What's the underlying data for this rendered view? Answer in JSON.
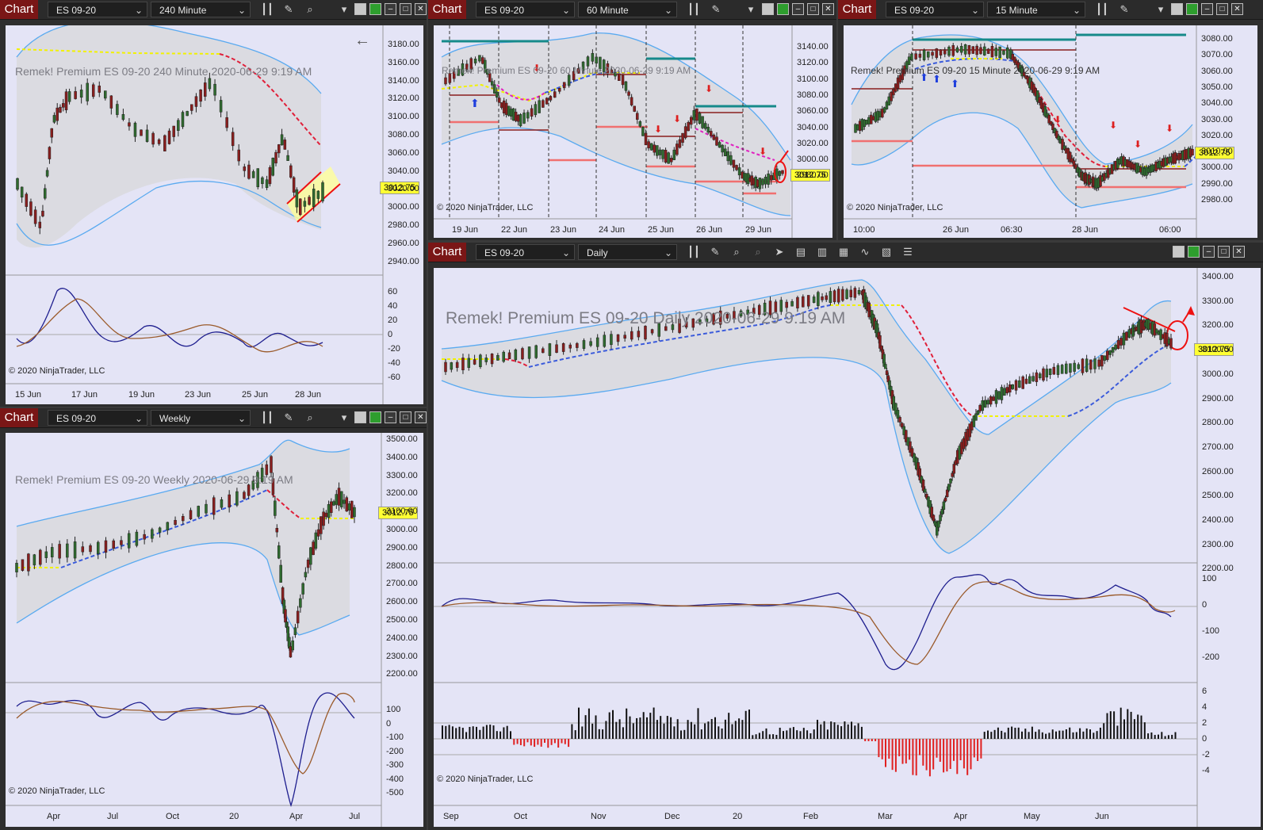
{
  "chart_windows": [
    {
      "tab": "Chart",
      "instrument": "ES 09-20",
      "period": "240 Minute",
      "overlay": "Remek!  Premium  ES 09-20  240 Minute  2020-06-29 9:19 AM",
      "copyright": "© 2020 NinjaTrader, LLC",
      "price_label": "3012.75",
      "x_ticks": [
        "15 Jun",
        "17 Jun",
        "19 Jun",
        "23 Jun",
        "25 Jun",
        "28 Jun"
      ],
      "y_ticks": [
        "3180.00",
        "3160.00",
        "3140.00",
        "3120.00",
        "3100.00",
        "3080.00",
        "3060.00",
        "3040.00",
        "3020.00",
        "3000.00",
        "2980.00",
        "2960.00",
        "2940.00"
      ],
      "osc_ticks": [
        "60",
        "40",
        "20",
        "0",
        "-20",
        "-40",
        "-60"
      ]
    },
    {
      "tab": "Chart",
      "instrument": "ES 09-20",
      "period": "60 Minute",
      "overlay": "Remek!  Premium  ES 09-20  60 Minute  2020-06-29 9:19 AM",
      "copyright": "© 2020 NinjaTrader, LLC",
      "price_label": "3012.75",
      "x_ticks": [
        "19 Jun",
        "22 Jun",
        "23 Jun",
        "24 Jun",
        "25 Jun",
        "26 Jun",
        "29 Jun"
      ],
      "y_ticks": [
        "3140.00",
        "3120.00",
        "3100.00",
        "3080.00",
        "3060.00",
        "3040.00",
        "3020.00",
        "3000.00",
        "2980.00"
      ]
    },
    {
      "tab": "Chart",
      "instrument": "ES 09-20",
      "period": "15 Minute",
      "overlay": "Remek!  Premium  ES 09-20  15 Minute  2020-06-29 9:19 AM",
      "copyright": "© 2020 NinjaTrader, LLC",
      "price_label": "3012.75",
      "x_ticks": [
        "10:00",
        "26 Jun",
        "06:30",
        "28 Jun",
        "06:00"
      ],
      "y_ticks": [
        "3080.00",
        "3070.00",
        "3060.00",
        "3050.00",
        "3040.00",
        "3030.00",
        "3020.00",
        "3010.00",
        "3000.00",
        "2990.00",
        "2980.00"
      ]
    },
    {
      "tab": "Chart",
      "instrument": "ES 09-20",
      "period": "Weekly",
      "overlay": "Remek!  Premium  ES 09-20  Weekly  2020-06-29 9:19 AM",
      "copyright": "© 2020 NinjaTrader, LLC",
      "price_label": "3012.75",
      "x_ticks": [
        "Apr",
        "Jul",
        "Oct",
        "20",
        "Apr",
        "Jul"
      ],
      "y_ticks": [
        "3500.00",
        "3400.00",
        "3300.00",
        "3200.00",
        "3100.00",
        "3000.00",
        "2900.00",
        "2800.00",
        "2700.00",
        "2600.00",
        "2500.00",
        "2400.00",
        "2300.00",
        "2200.00"
      ],
      "osc_ticks": [
        "100",
        "0",
        "-100",
        "-200",
        "-300",
        "-400",
        "-500"
      ]
    },
    {
      "tab": "Chart",
      "instrument": "ES 09-20",
      "period": "Daily",
      "overlay": "Remek!  Premium  ES 09-20  Daily  2020-06-29 9:19 AM",
      "copyright": "© 2020 NinjaTrader, LLC",
      "price_label": "3012.75",
      "x_ticks": [
        "Sep",
        "Oct",
        "Nov",
        "Dec",
        "20",
        "Feb",
        "Mar",
        "Apr",
        "May",
        "Jun"
      ],
      "y_ticks": [
        "3400.00",
        "3300.00",
        "3200.00",
        "3100.00",
        "3000.00",
        "2900.00",
        "2800.00",
        "2700.00",
        "2600.00",
        "2500.00",
        "2400.00",
        "2300.00",
        "2200.00"
      ],
      "osc_ticks": [
        "100",
        "0",
        "-100",
        "-200"
      ],
      "hist_ticks": [
        "6",
        "4",
        "2",
        "0",
        "-2",
        "-4"
      ]
    }
  ],
  "colors": {
    "bg": "#e4e4f6",
    "band": "#5aaaf0",
    "up": "#2f6b2f",
    "down": "#8a1e1e",
    "price_label": "#ffff33",
    "tab": "#7a1616",
    "osc_fast": "#1f1f8f",
    "osc_slow": "#9a5a2a"
  },
  "icons": [
    "bars-icon",
    "pencil-icon",
    "zoom-icon",
    "chevron-down-icon",
    "cursor-icon",
    "window-min-icon",
    "window-restore-icon",
    "window-max-icon",
    "close-icon",
    "back-arrow-icon"
  ]
}
